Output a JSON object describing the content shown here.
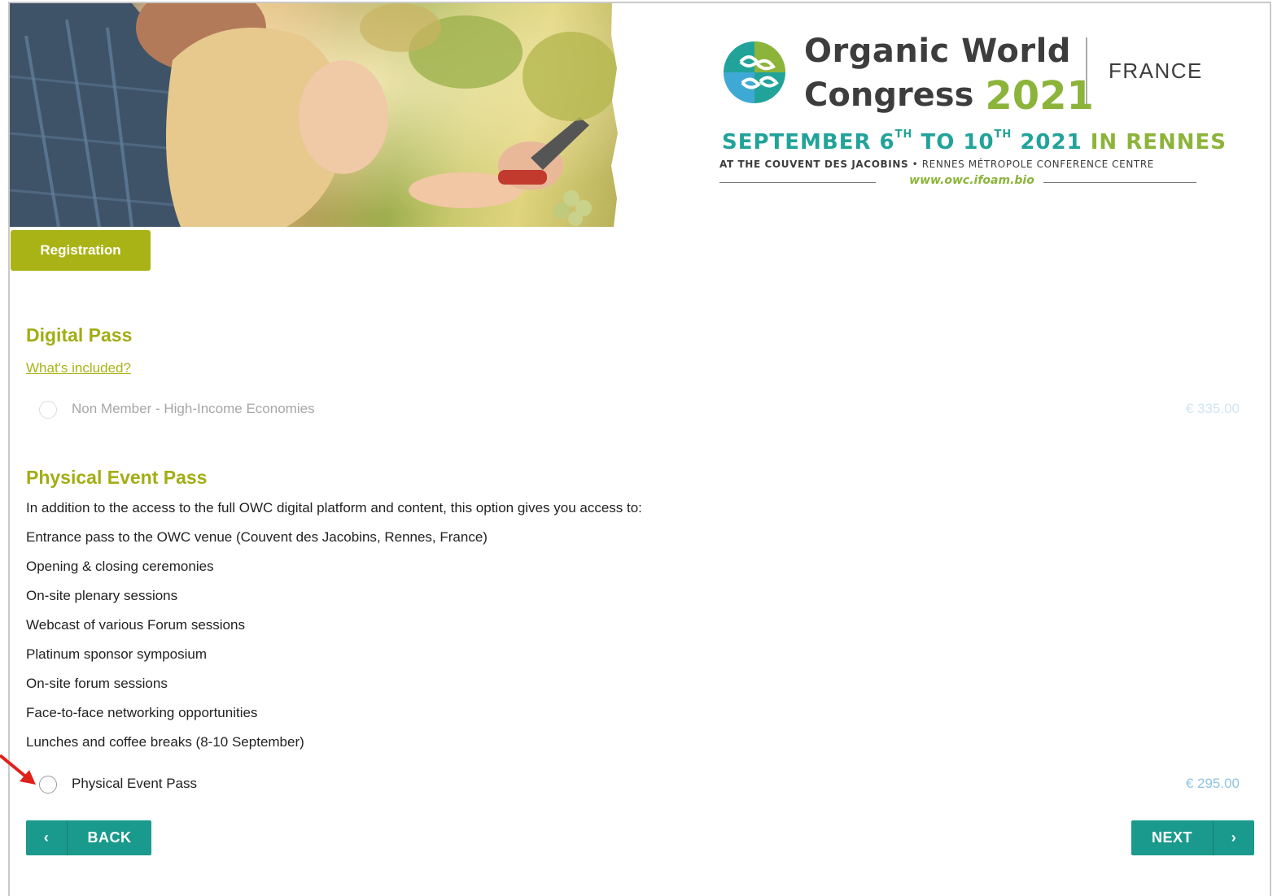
{
  "header": {
    "title_line1": "Organic World",
    "title_line2": "Congress",
    "year": "2021",
    "country": "FRANCE",
    "dates": {
      "part1": "SEPTEMBER 6",
      "sup1": "TH",
      "part2": " TO 10",
      "sup2": "TH",
      "part3": " 2021 ",
      "part4": "IN RENNES"
    },
    "venue_bold": "AT THE COUVENT DES JACOBINS",
    "venue_sep": " • ",
    "venue_rest": "RENNES MÉTROPOLE CONFERENCE CENTRE",
    "url": "www.owc.ifoam.bio"
  },
  "tabs": {
    "registration": "Registration"
  },
  "digital_pass": {
    "title": "Digital Pass",
    "link": "What's included?",
    "option": {
      "label": "Non Member - High-Income Economies",
      "price": "€ 335.00"
    }
  },
  "physical_pass": {
    "title": "Physical Event Pass",
    "items": [
      "In addition to the access to the full OWC digital platform and content, this option gives you access to:",
      "Entrance pass to the OWC venue (Couvent des Jacobins, Rennes, France)",
      "Opening & closing ceremonies",
      "On-site plenary sessions",
      "Webcast of various Forum sessions",
      "Platinum sponsor symposium",
      "On-site forum sessions",
      "Face-to-face networking opportunities",
      "Lunches and coffee breaks (8-10 September)"
    ],
    "option": {
      "label": "Physical Event Pass",
      "price": "€ 295.00"
    }
  },
  "nav": {
    "back": "BACK",
    "back_icon": "‹",
    "next": "NEXT",
    "next_icon": "›"
  },
  "colors": {
    "accent": "#aab316",
    "button": "#1a9a8c",
    "price": "#8fc4e4",
    "logo_teal": "#21a39a",
    "logo_green": "#8cb43a"
  }
}
